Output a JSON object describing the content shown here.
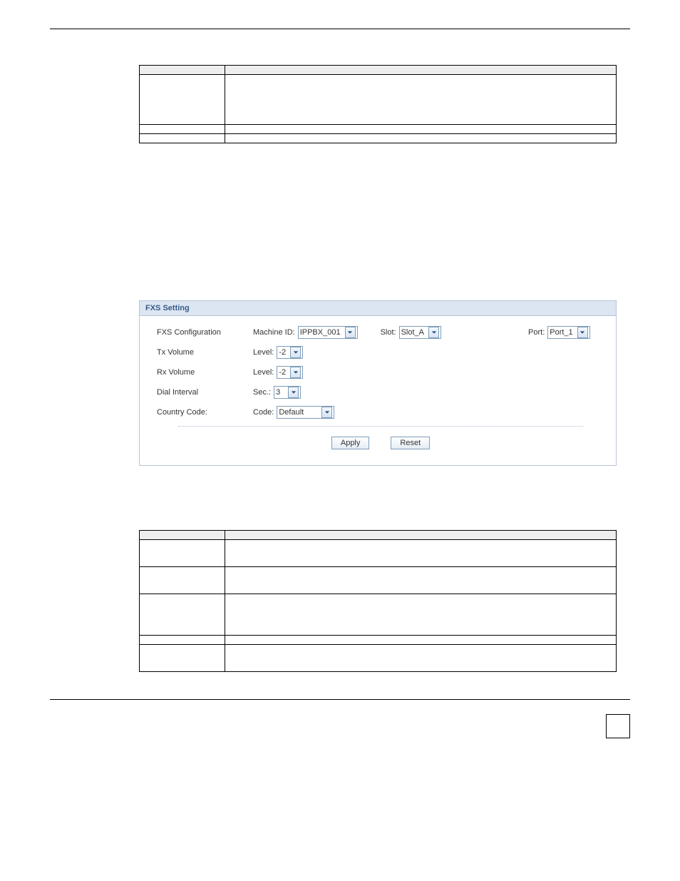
{
  "top_table": {
    "headers": [
      "",
      ""
    ],
    "rows": [
      {
        "label": "",
        "desc": ""
      },
      {
        "label": "",
        "desc": ""
      },
      {
        "label": "",
        "desc": ""
      }
    ]
  },
  "fxs": {
    "title": "FXS Setting",
    "rows": {
      "config": {
        "label": "FXS Configuration",
        "machine_id_label": "Machine ID:",
        "machine_id_value": "IPPBX_001",
        "slot_label": "Slot:",
        "slot_value": "Slot_A",
        "port_label": "Port:",
        "port_value": "Port_1"
      },
      "tx": {
        "label": "Tx Volume",
        "level_label": "Level:",
        "level_value": "-2"
      },
      "rx": {
        "label": "Rx Volume",
        "level_label": "Level:",
        "level_value": "-2"
      },
      "dial": {
        "label": "Dial Interval",
        "sec_label": "Sec.:",
        "sec_value": "3"
      },
      "country": {
        "label": "Country Code:",
        "code_label": "Code:",
        "code_value": "Default"
      }
    },
    "buttons": {
      "apply": "Apply",
      "reset": "Reset"
    }
  },
  "bottom_table": {
    "headers": [
      "",
      ""
    ],
    "rows": [
      {
        "label": "",
        "desc": ""
      },
      {
        "label": "",
        "desc": ""
      },
      {
        "label": "",
        "desc": ""
      },
      {
        "label": "",
        "desc": ""
      },
      {
        "label": "",
        "desc": ""
      }
    ]
  },
  "icons": {
    "chevron_down": "chevron-down-icon"
  }
}
